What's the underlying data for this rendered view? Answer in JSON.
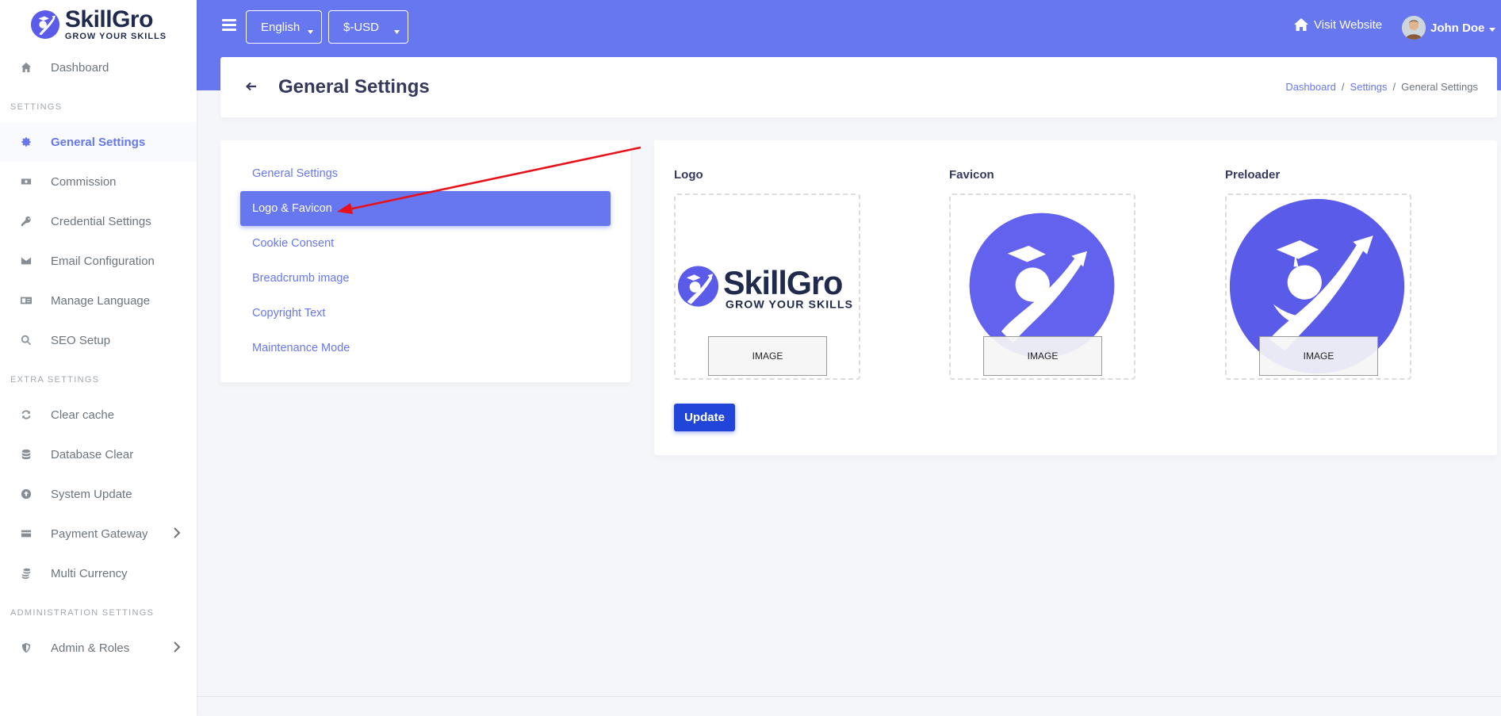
{
  "brand": {
    "name": "SkillGro",
    "tagline": "GROW YOUR SKILLS"
  },
  "sidebar": {
    "items_top": [
      {
        "label": "Dashboard",
        "icon": "home-icon"
      }
    ],
    "section_settings": "SETTINGS",
    "settings_items": [
      {
        "label": "General Settings",
        "icon": "gear-icon",
        "active": true
      },
      {
        "label": "Commission",
        "icon": "money-icon"
      },
      {
        "label": "Credential Settings",
        "icon": "key-icon"
      },
      {
        "label": "Email Configuration",
        "icon": "envelope-icon"
      },
      {
        "label": "Manage Language",
        "icon": "language-icon"
      },
      {
        "label": "SEO Setup",
        "icon": "search-icon"
      }
    ],
    "section_extra": "EXTRA SETTINGS",
    "extra_items": [
      {
        "label": "Clear cache",
        "icon": "sync-icon"
      },
      {
        "label": "Database Clear",
        "icon": "database-icon"
      },
      {
        "label": "System Update",
        "icon": "upload-icon"
      },
      {
        "label": "Payment Gateway",
        "icon": "credit-card-icon"
      },
      {
        "label": "Multi Currency",
        "icon": "coins-icon"
      }
    ],
    "section_admin": "ADMINISTRATION SETTINGS",
    "admin_items": [
      {
        "label": "Admin & Roles",
        "icon": "shield-icon"
      }
    ]
  },
  "topbar": {
    "language": "English",
    "currency": "$-USD",
    "visit_website": "Visit Website",
    "user_name": "John Doe"
  },
  "header": {
    "title": "General Settings",
    "breadcrumb": [
      "Dashboard",
      "Settings",
      "General Settings"
    ]
  },
  "settings_menu": [
    {
      "label": "General Settings"
    },
    {
      "label": "Logo & Favicon",
      "active": true
    },
    {
      "label": "Cookie Consent"
    },
    {
      "label": "Breadcrumb image"
    },
    {
      "label": "Copyright Text"
    },
    {
      "label": "Maintenance Mode"
    }
  ],
  "form": {
    "logo_label": "Logo",
    "favicon_label": "Favicon",
    "preloader_label": "Preloader",
    "image_button": "IMAGE",
    "update_button": "Update"
  },
  "colors": {
    "primary": "#6777ef",
    "button": "#2145d9",
    "annotation_arrow": "#e8111a"
  }
}
